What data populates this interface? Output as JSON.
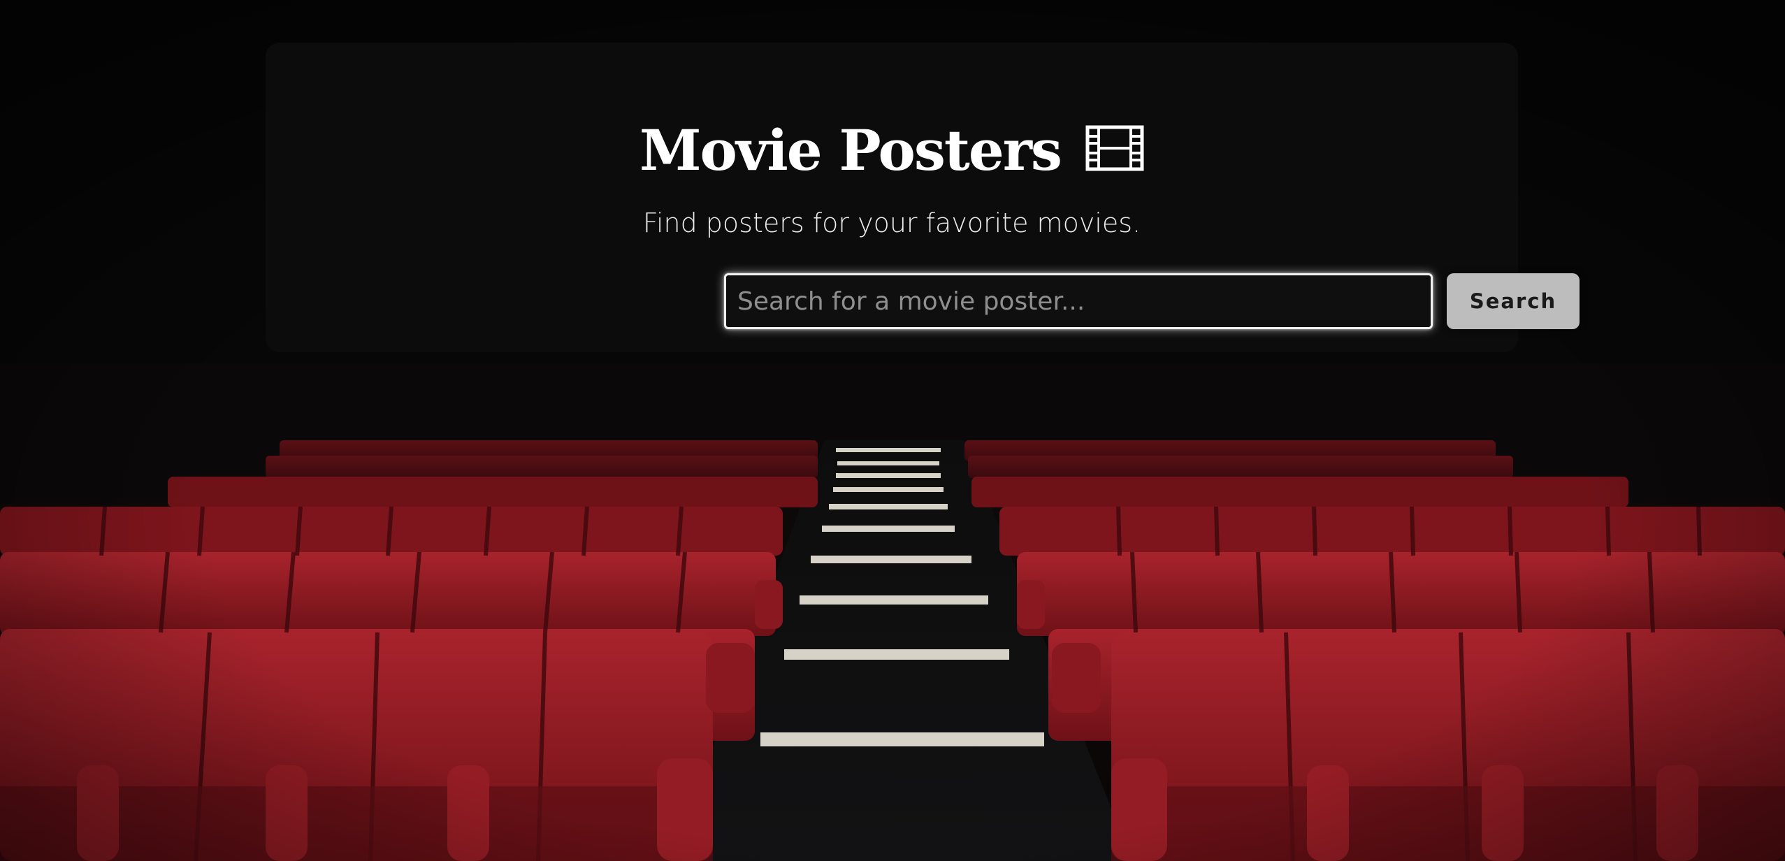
{
  "header": {
    "title": "Movie Posters",
    "title_icon": "film-icon",
    "subtitle": "Find posters for your favorite movies."
  },
  "search": {
    "placeholder": "Search for a movie poster...",
    "value": "",
    "button_label": "Search"
  },
  "background": {
    "description_icon": "theater-seats-image",
    "seat_color": "#8e1a22",
    "stair_color": "#d8d4cc"
  },
  "colors": {
    "card_background": "#0c0c0c",
    "button_background": "#bdbdbd",
    "title_text": "#ffffff"
  }
}
